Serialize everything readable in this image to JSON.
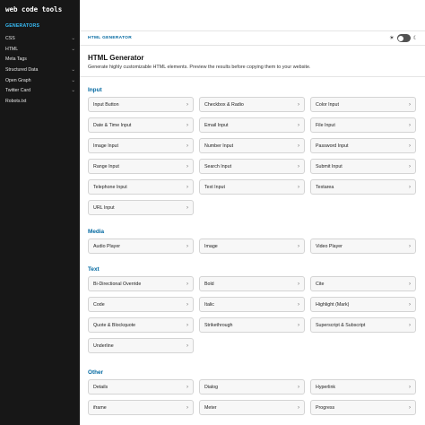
{
  "sidebar": {
    "brand": "web code tools",
    "section_label": "GENERATORS",
    "items": [
      {
        "label": "CSS"
      },
      {
        "label": "HTML"
      },
      {
        "label": "Meta Tags"
      },
      {
        "label": "Structured Data"
      },
      {
        "label": "Open Graph"
      },
      {
        "label": "Twitter Card"
      },
      {
        "label": "Robots.txt"
      }
    ]
  },
  "header": {
    "breadcrumb": "HTML GENERATOR",
    "sun_icon": "☀",
    "moon_icon": "☾"
  },
  "main": {
    "title": "HTML Generator",
    "description": "Generate highly customizable HTML elements. Preview the results before copying them to your website.",
    "groups": [
      {
        "title": "Input",
        "items": [
          "Input Button",
          "Checkbox & Radio",
          "Color Input",
          "Date & Time Input",
          "Email Input",
          "File Input",
          "Image Input",
          "Number Input",
          "Password Input",
          "Range Input",
          "Search Input",
          "Submit Input",
          "Telephone Input",
          "Text Input",
          "Textarea",
          "URL Input"
        ]
      },
      {
        "title": "Media",
        "items": [
          "Audio Player",
          "Image",
          "Video Player"
        ]
      },
      {
        "title": "Text",
        "items": [
          "Bi-Directional Override",
          "Bold",
          "Cite",
          "Code",
          "Italic",
          "Highlight (Mark)",
          "Quote & Blockquote",
          "Strikethrough",
          "Superscript & Subscript",
          "Underline"
        ]
      },
      {
        "title": "Other",
        "items": [
          "Details",
          "Dialog",
          "Hyperlink",
          "iframe",
          "Meter",
          "Progress"
        ]
      }
    ]
  },
  "colors": {
    "sidebar_bg": "#171717",
    "accent": "#0369a1",
    "section_label": "#38bdf8"
  }
}
